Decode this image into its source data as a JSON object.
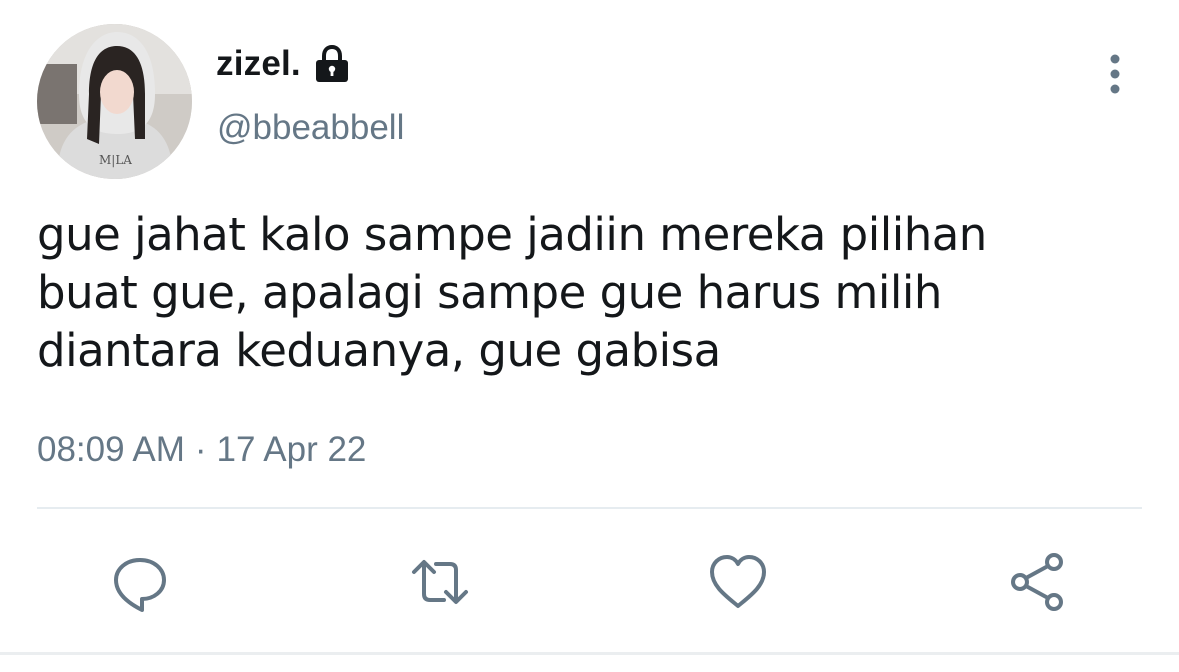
{
  "user": {
    "display_name": "zizel.",
    "handle": "@bbeabbell",
    "protected": true,
    "avatar_icon": "profile-photo"
  },
  "tweet": {
    "text": "gue jahat kalo sampe jadiin mereka pilihan\nbuat gue, apalagi sampe gue harus milih\ndiantara keduanya, gue gabisa",
    "time": "08:09 AM",
    "separator": "·",
    "date": "17 Apr 22"
  },
  "actions": [
    {
      "name": "reply",
      "icon": "speech-bubble-icon"
    },
    {
      "name": "retweet",
      "icon": "retweet-arrows-icon"
    },
    {
      "name": "like",
      "icon": "heart-icon"
    },
    {
      "name": "share",
      "icon": "share-nodes-icon"
    }
  ],
  "colors": {
    "text_primary": "#14171a",
    "text_secondary": "#657786",
    "icon": "#657786",
    "divider": "#e6ecf0",
    "background": "#ffffff"
  }
}
